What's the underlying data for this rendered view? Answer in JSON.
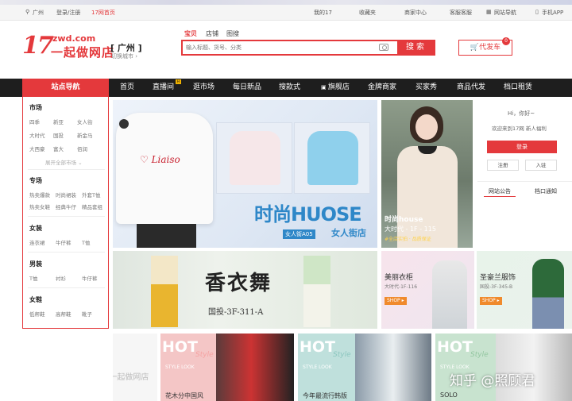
{
  "topbar": {
    "city": "广州",
    "login": "登录/注册",
    "home": "17网首页",
    "my17": "我的17",
    "favorites": "收藏夹",
    "merchant": "商家中心",
    "service": "客服客服",
    "sitenav": "网站导航",
    "mobile": "手机APP"
  },
  "header": {
    "logo_num": "17",
    "logo_domain": "zwd.com",
    "logo_cn": "一起做网店",
    "city": "[ 广州 ]",
    "city_switch": "切换城市 ›",
    "search_tabs": [
      "宝贝",
      "店铺",
      "图搜"
    ],
    "search_placeholder": "输入标题、货号、分类",
    "search_button": "搜索",
    "cart_button": "代发车",
    "cart_count": "0"
  },
  "nav": {
    "home_label": "站点导航",
    "items": [
      "首页",
      "直播间",
      "逛市场",
      "每日新品",
      "搜款式",
      "旗舰店",
      "金牌商家",
      "买家秀",
      "商品代发",
      "档口租赁"
    ],
    "hot_badge": "H"
  },
  "sidebar": {
    "sections": [
      {
        "title": "市场",
        "items": [
          "四季",
          "新亚",
          "女人街",
          "大时代",
          "国投",
          "新金马",
          "大西豪",
          "富大",
          "佰润"
        ],
        "more": "展开全部市场 ⌄"
      },
      {
        "title": "专场",
        "items": [
          "热卖爆款",
          "时尚裙装",
          "外套T恤",
          "热卖女鞋",
          "经典牛仔",
          "精品套组"
        ]
      },
      {
        "title": "女装",
        "items": [
          "连衣裙",
          "牛仔裤",
          "T恤"
        ]
      },
      {
        "title": "男装",
        "items": [
          "T恤",
          "衬衫",
          "牛仔裤"
        ]
      },
      {
        "title": "女鞋",
        "items": [
          "低帮鞋",
          "高帮鞋",
          "靴子"
        ]
      }
    ]
  },
  "banner_main": {
    "brand": "时尚HUOSE",
    "shop_tag": "女人街A05",
    "shop_tag2": "女人街店"
  },
  "banner_girl": {
    "title": "时尚house",
    "sub": "大时代 - 1F - 115",
    "note": "#全店实拍 · 品质保证"
  },
  "banner_xiang": {
    "title": "香衣舞",
    "sub": "国投-3F-311-A"
  },
  "small_banners": [
    {
      "title": "美丽衣柜",
      "sub": "大时代-1F-116",
      "btn": "SHOP ▸"
    },
    {
      "title": "圣豪兰服饰",
      "sub": "国投-3F-345-B",
      "btn": "SHOP ▸"
    }
  ],
  "right_panel": {
    "greeting": "Hi，你好~",
    "welcome": "欢迎来到17网 新人福利",
    "login": "登录",
    "register": "注册",
    "settle": "入驻",
    "tabs": [
      "网站公告",
      "档口通知"
    ]
  },
  "bottom_row": [
    {
      "title": "HOT",
      "sub": "Style",
      "sub2": "STYLE LOOK",
      "caption": "花木分中国风"
    },
    {
      "title": "HOT",
      "sub": "Style",
      "sub2": "STYLE LOOK",
      "caption": "今年最流行韩版"
    },
    {
      "title": "HOT",
      "sub": "Style",
      "sub2": "STYLE LOOK",
      "caption": "SOLO"
    }
  ],
  "watermark_logo": "17 zwd.com 一起做网店",
  "watermark": "知乎 @照顾君",
  "colors": {
    "brand": "#e4393c",
    "nav": "#1e1e1e"
  }
}
